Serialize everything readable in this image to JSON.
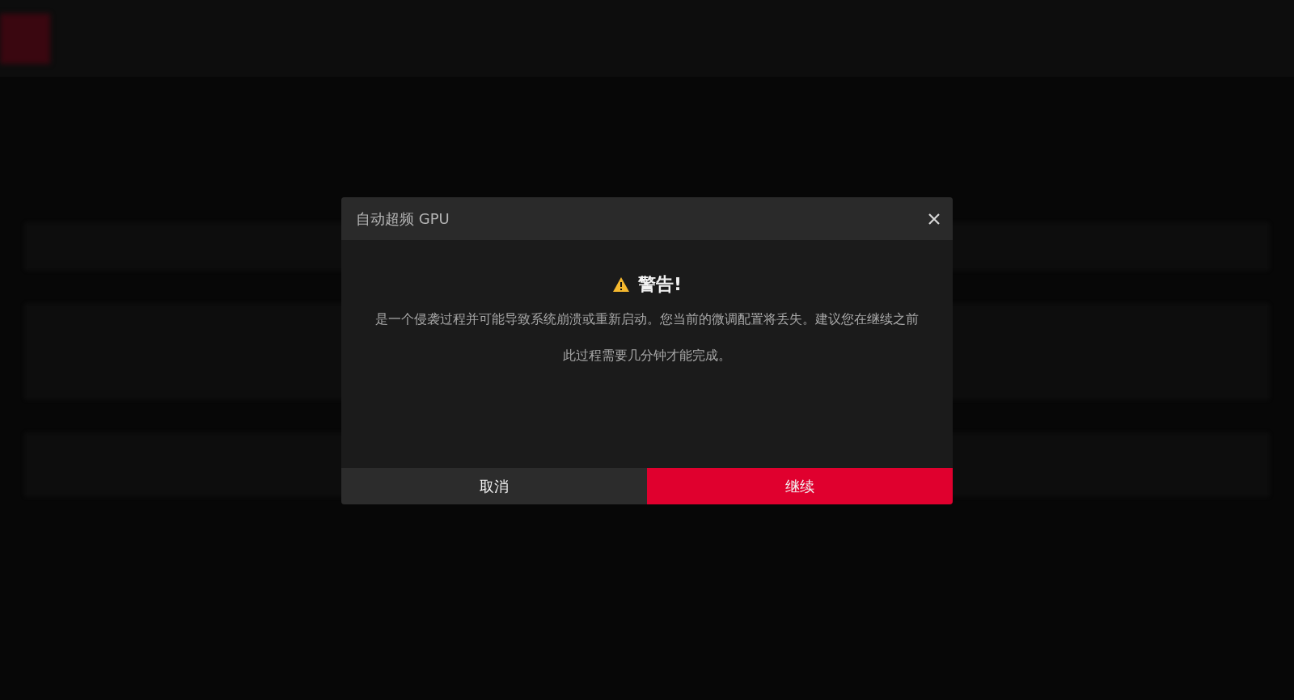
{
  "dialog": {
    "title": "自动超频 GPU",
    "heading": "警告!",
    "messages": [
      "是一个侵袭过程并可能导致系统崩溃或重新启动。您当前的微调配置将丢失。建议您在继续之前",
      "此过程需要几分钟才能完成。"
    ],
    "buttons": [
      {
        "label": "取消",
        "kind": "secondary"
      },
      {
        "label": "继续",
        "kind": "primary"
      }
    ]
  }
}
